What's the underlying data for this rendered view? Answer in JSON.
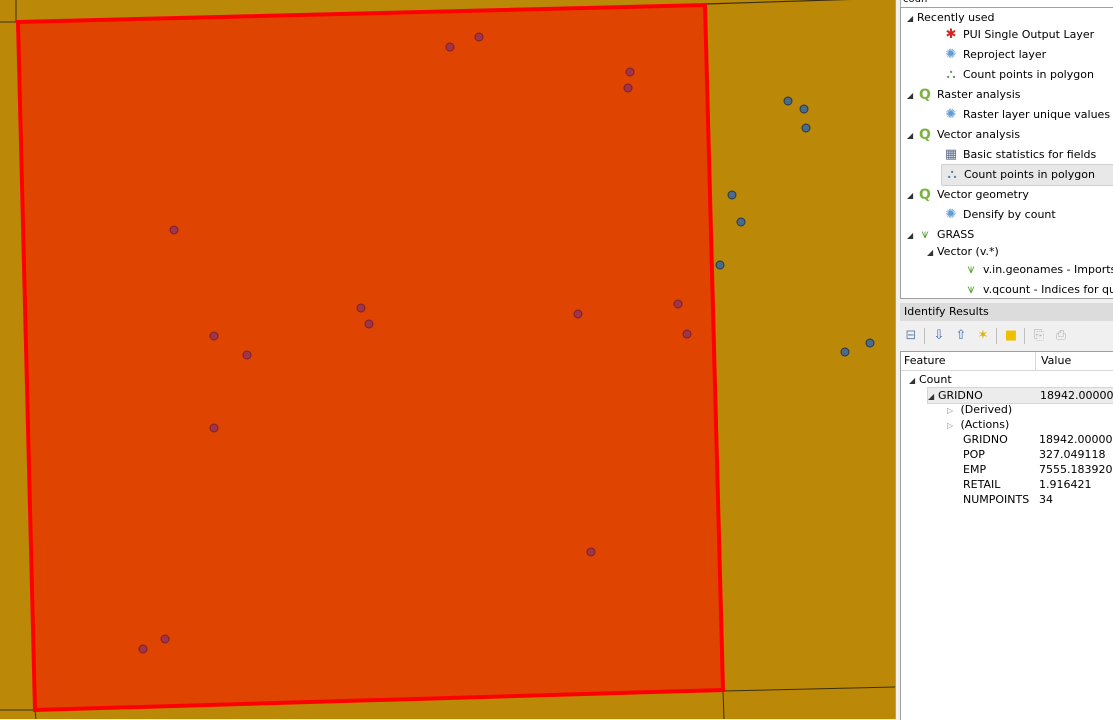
{
  "map": {
    "background_color": "#bb8807",
    "selected_polygon_fill": "#df4501",
    "selected_polygon_stroke": "#ff0000",
    "inside_point_color": "#a0344a",
    "outside_point_color": "#4a6b8a",
    "grid_line_color": "#3a3010"
  },
  "toolbox": {
    "search_value": "coun",
    "groups": [
      {
        "label": "Recently used",
        "icon": "none",
        "items": [
          {
            "label": "PUI Single Output Layer",
            "icon": "model-icon"
          },
          {
            "label": "Reproject layer",
            "icon": "gear-icon"
          },
          {
            "label": "Count points in polygon",
            "icon": "count-points-icon"
          }
        ]
      },
      {
        "label": "Raster analysis",
        "icon": "qgis-icon",
        "items": [
          {
            "label": "Raster layer unique values report",
            "icon": "gear-icon"
          }
        ]
      },
      {
        "label": "Vector analysis",
        "icon": "qgis-icon",
        "items": [
          {
            "label": "Basic statistics for fields",
            "icon": "table-icon"
          },
          {
            "label": "Count points in polygon",
            "icon": "count-points-icon",
            "selected": true
          }
        ]
      },
      {
        "label": "Vector geometry",
        "icon": "qgis-icon",
        "items": [
          {
            "label": "Densify by count",
            "icon": "gear-icon"
          }
        ]
      },
      {
        "label": "GRASS",
        "icon": "grass-icon",
        "subgroup": {
          "label": "Vector (v.*)",
          "items": [
            {
              "label": "v.in.geonames - Imports geonames.org country files",
              "icon": "grass-icon"
            },
            {
              "label": "v.qcount - Indices for quadrat counts of vector point lists",
              "icon": "grass-icon"
            }
          ]
        }
      }
    ]
  },
  "identify": {
    "title": "Identify Results",
    "columns": {
      "feature": "Feature",
      "value": "Value"
    },
    "layer": "Count",
    "feature_field": "GRIDNO",
    "feature_value": "18942.00000",
    "derived": "(Derived)",
    "actions": "(Actions)",
    "attributes": [
      {
        "name": "GRIDNO",
        "value": "18942.00000"
      },
      {
        "name": "POP",
        "value": "327.049118"
      },
      {
        "name": "EMP",
        "value": "7555.183920"
      },
      {
        "name": "RETAIL",
        "value": "1.916421"
      },
      {
        "name": "NUMPOINTS",
        "value": "34"
      }
    ]
  }
}
